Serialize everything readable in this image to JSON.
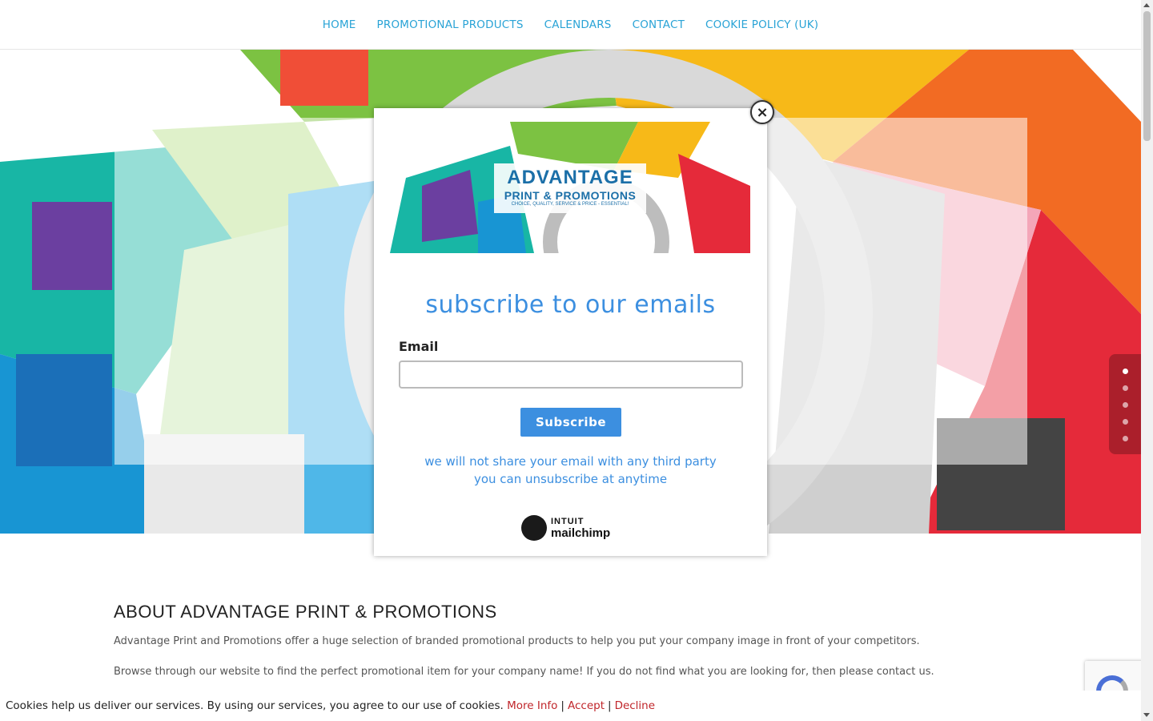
{
  "nav": {
    "items": [
      {
        "label": "HOME"
      },
      {
        "label": "PROMOTIONAL PRODUCTS"
      },
      {
        "label": "CALENDARS"
      },
      {
        "label": "CONTACT"
      },
      {
        "label": "COOKIE POLICY (UK)"
      }
    ]
  },
  "hero": {
    "slider_dots": 5,
    "active_dot": 1
  },
  "popup": {
    "logo_main": "ADVANTAGE",
    "logo_sub": "PRINT & PROMOTIONS",
    "logo_tag": "CHOICE, QUALITY, SERVICE & PRICE - ESSENTIAL!",
    "close_label": "×",
    "heading": "subscribe to our emails",
    "email_label": "Email",
    "email_value": "",
    "subscribe_label": "Subscribe",
    "privacy_line1": "we will not share your email with any third party",
    "privacy_line2": "you can unsubscribe at anytime",
    "badge_top": "INTUIT",
    "badge_bottom": "mailchimp"
  },
  "about": {
    "title": "ABOUT ADVANTAGE PRINT & PROMOTIONS",
    "p1": "Advantage Print and Promotions offer a huge selection of branded promotional products to help you put your company image in front of your competitors.",
    "p2": "Browse through our website to find the perfect promotional item for your company name! If you do not find what you are looking for, then please contact us."
  },
  "cookie": {
    "text": "Cookies help us deliver our services. By using our services, you agree to our use of cookies.",
    "more_info": "More Info",
    "accept": "Accept",
    "decline": "Decline",
    "separator": "|"
  },
  "colors": {
    "nav_link": "#29a3d6",
    "popup_accent": "#3c8fe0",
    "cookie_link": "#c0262b"
  }
}
